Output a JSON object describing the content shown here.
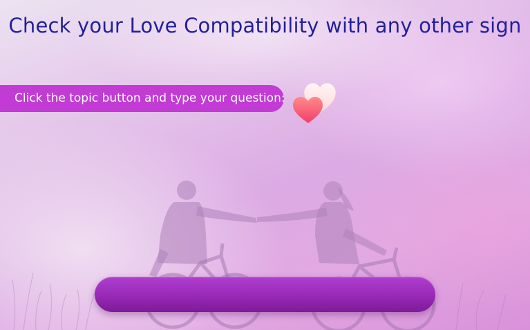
{
  "page": {
    "title": "Check your Love Compatibility with any other sign",
    "instruction": "Click the topic button and type your question:"
  },
  "topic_button": {
    "label": ""
  },
  "icons": {
    "hearts": "two-hearts-icon"
  },
  "colors": {
    "title": "#221f9a",
    "pill": "#c23bd4",
    "button": "#9a2bb9",
    "heart_front": "#f5566e",
    "heart_back": "#ffe6e9"
  }
}
